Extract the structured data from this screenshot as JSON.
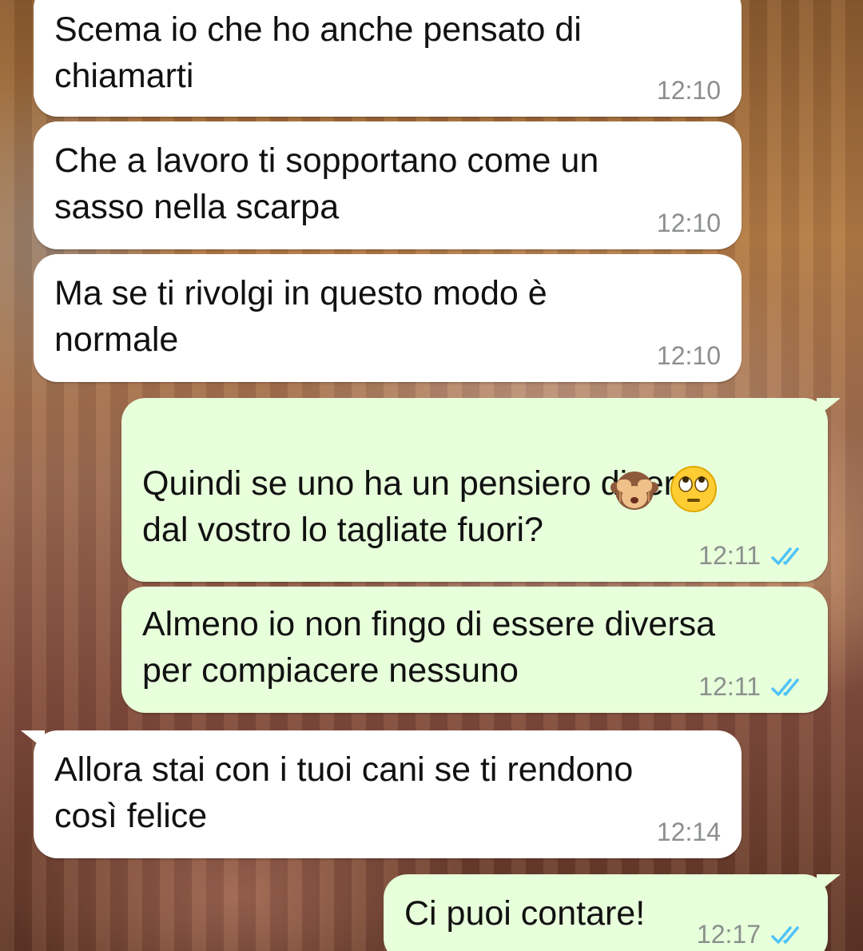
{
  "colors": {
    "incoming_bubble": "#ffffff",
    "outgoing_bubble": "#e7ffdb",
    "timestamp": "#8b8f8c",
    "read_ticks": "#4fc3f7"
  },
  "messages": [
    {
      "direction": "incoming",
      "text": "Scema io che ho anche pensato di\nchiamarti",
      "time": "12:10"
    },
    {
      "direction": "incoming",
      "text": "Che a lavoro ti sopportano come un\nsasso nella scarpa",
      "time": "12:10"
    },
    {
      "direction": "incoming",
      "text": "Ma se ti rivolgi in questo modo è\nnormale",
      "time": "12:10"
    },
    {
      "direction": "outgoing",
      "text": "Quindi se uno ha un pensiero diverso\ndal vostro lo tagliate fuori?",
      "emojis": [
        "see-no-evil-monkey-icon",
        "eye-roll-face-icon"
      ],
      "time": "12:11",
      "status": "read-double-check-icon"
    },
    {
      "direction": "outgoing",
      "text": "Almeno io non fingo di essere diversa\nper compiacere nessuno",
      "time": "12:11",
      "status": "read-double-check-icon"
    },
    {
      "direction": "incoming",
      "text": "Allora stai con i tuoi cani se ti rendono\ncosì felice",
      "time": "12:14"
    },
    {
      "direction": "outgoing",
      "text": "Ci puoi contare!",
      "time": "12:17",
      "status": "read-double-check-icon"
    }
  ]
}
